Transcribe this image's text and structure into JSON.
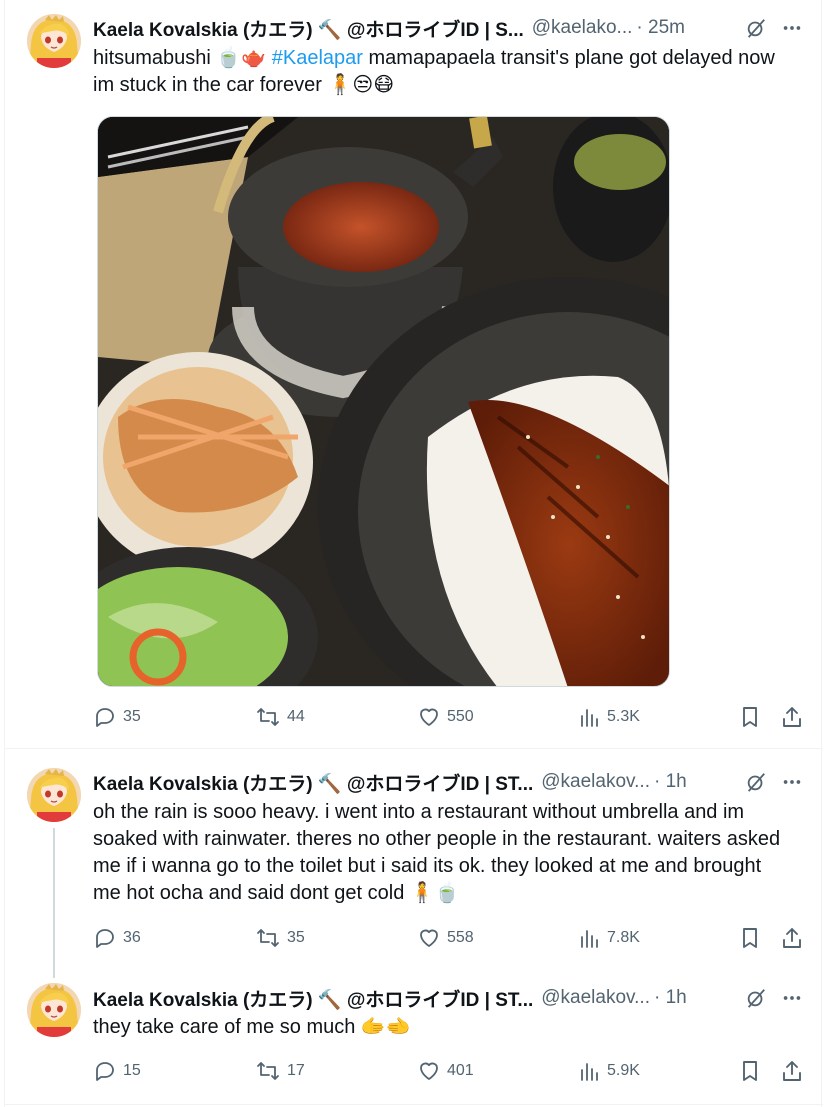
{
  "tweets": [
    {
      "name": "Kaela Kovalskia (カエラ) 🔨 @ホロライブID | S...",
      "handle": "@kaelako...",
      "time": "· 25m",
      "text_before": "hitsumabushi 🍵🫖 ",
      "hashtag": "#Kaelapar",
      "text_after": " mamapapaela transit's plane got delayed now im stuck in the car forever 🧍😒😷",
      "replies": "35",
      "reposts": "44",
      "likes": "550",
      "views": "5.3K",
      "media_icon": "food-photo"
    },
    {
      "name": "Kaela Kovalskia (カエラ) 🔨 @ホロライブID | ST...",
      "handle": "@kaelakov...",
      "time": "· 1h",
      "text": "oh the rain is sooo heavy. i went into a restaurant without umbrella and im soaked with rainwater. theres no other people in the restaurant. waiters asked me if i wanna go to the toilet but i said its ok. they looked at me and brought me hot ocha and said dont get cold 🧍🍵",
      "replies": "36",
      "reposts": "35",
      "likes": "558",
      "views": "7.8K"
    },
    {
      "name": "Kaela Kovalskia (カエラ) 🔨 @ホロライブID | ST...",
      "handle": "@kaelakov...",
      "time": "· 1h",
      "text": "they take care of me so much 🫱🫲",
      "replies": "15",
      "reposts": "17",
      "likes": "401",
      "views": "5.9K"
    }
  ],
  "colors": {
    "text": "#0f1419",
    "secondary": "#536471",
    "link": "#1d9bf0",
    "border": "#eff3f4"
  }
}
